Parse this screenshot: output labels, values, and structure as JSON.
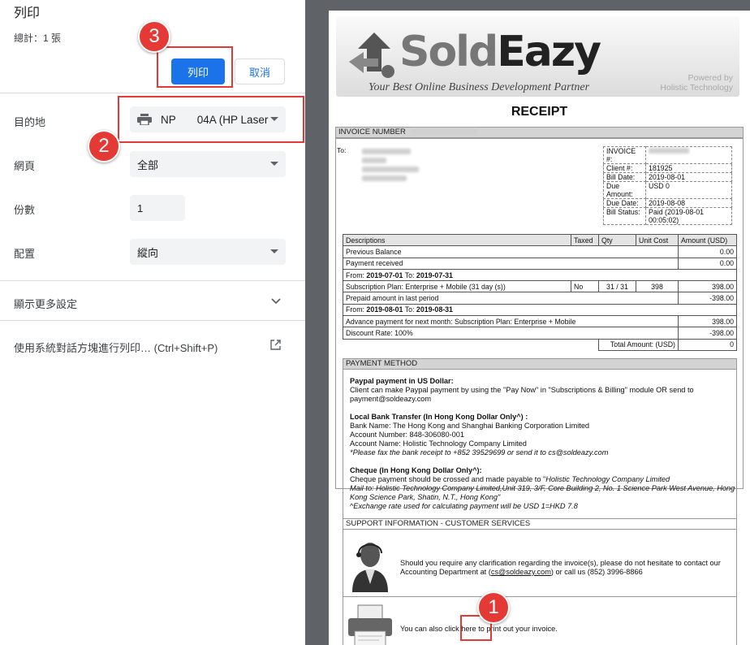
{
  "dialog": {
    "title": "列印",
    "total": "總計：1 張",
    "print_button": "列印",
    "cancel_button": "取消",
    "destination_label": "目的地",
    "destination_value": "NP       04A (HP Laser",
    "pages_label": "網頁",
    "pages_value": "全部",
    "copies_label": "份數",
    "copies_value": "1",
    "layout_label": "配置",
    "layout_value": "縱向",
    "more_settings": "顯示更多設定",
    "system_dialog": "使用系統對話方塊進行列印… (Ctrl+Shift+P)"
  },
  "annotations": [
    {
      "number": "1"
    },
    {
      "number": "2"
    },
    {
      "number": "3"
    }
  ],
  "receipt": {
    "logo_text_1": "Sold",
    "logo_text_2": "Eazy",
    "tagline": "Your Best Online Business Development Partner",
    "powered_1": "Powered by",
    "powered_2": "Holistic Technology",
    "title": "RECEIPT",
    "invoice_number_label": "INVOICE NUMBER",
    "to_label": "To:",
    "info": [
      {
        "label": "INVOICE #:",
        "value": ""
      },
      {
        "label": "Client #:",
        "value": "181925"
      },
      {
        "label": "Bill Date:",
        "value": "2019-08-01"
      },
      {
        "label": "Due Amount:",
        "value": "USD 0"
      },
      {
        "label": "Due Date:",
        "value": "2019-08-08"
      },
      {
        "label": "Bill Status:",
        "value": "Paid (2019-08-01 00:05:02)"
      }
    ],
    "table_headers": [
      "Descriptions",
      "Taxed",
      "Qty",
      "Unit Cost",
      "Amount (USD)"
    ],
    "rows": [
      {
        "desc": "Previous Balance",
        "amount": "0.00"
      },
      {
        "desc": "Payment received",
        "amount": "0.00"
      },
      {
        "from_label": "From:",
        "from": "2019-07-01",
        "to_label": "To:",
        "to": "2019-07-31"
      },
      {
        "desc": "Subscription Plan: Enterprise + Mobile (31 day (s))",
        "taxed": "No",
        "qty": "31 / 31",
        "unit": "398",
        "amount": "398.00"
      },
      {
        "desc": "Prepaid amount in last period",
        "amount": "-398.00"
      },
      {
        "from_label": "From:",
        "from": "2019-08-01",
        "to_label": "To:",
        "to": "2019-08-31"
      },
      {
        "desc": "Advance payment for next month: Subscription Plan: Enterprise + Mobile",
        "amount": "398.00"
      },
      {
        "desc": "Discount Rate: 100%",
        "amount": "-398.00"
      }
    ],
    "total_label": "Total Amount: (USD)",
    "total_value": "0",
    "payment_method_label": "PAYMENT METHOD",
    "paypal_title": "Paypal payment in US Dollar:",
    "paypal_text": "Client can make Paypal payment by using the \"Pay Now\" in \"Subscriptions & Billing\" module OR send to payment@soldeazy.com",
    "bank_title": "Local Bank Transfer (In Hong Kong Dollar Only^) :",
    "bank_line1": "Bank Name: The Hong Kong and Shanghai Banking Corporation Limited",
    "bank_line2": "Account Number: 848-306080-001",
    "bank_line3": "Account Name: Holistic Technology Company Limited",
    "bank_line4": "*Please fax the bank receipt to +852 39529699 or send it to cs@soldeazy.com",
    "cheque_title": "Cheque (In Hong Kong Dollar Only^):",
    "cheque_line1a": "Cheque payment should be crossed and made payable to \"",
    "cheque_line1b": "Holistic Technology Company Limited",
    "cheque_line2": "Mail to: Holistic Technology Company Limited,Unit 319, 3/F, Core Building 2, No. 1 Science Park West Avenue, Hong Kong Science Park, Shatin, N.T., Hong Kong\"",
    "cheque_line3": "^Exchange rate used for calculating payment will be USD 1=HKD 7.8",
    "support_label": "SUPPORT INFORMATION - CUSTOMER SERVICES",
    "support_text_1": "Should you require any clarification regarding the invoice(s), please do not hesitate to contact our Accounting Department at (",
    "support_email": "cs@soldeazy.com",
    "support_text_2": ") or call us (852) 3996-8866",
    "print_text_1": "You can also ",
    "print_link": "click here",
    "print_text_2": " to print out your invoice."
  }
}
